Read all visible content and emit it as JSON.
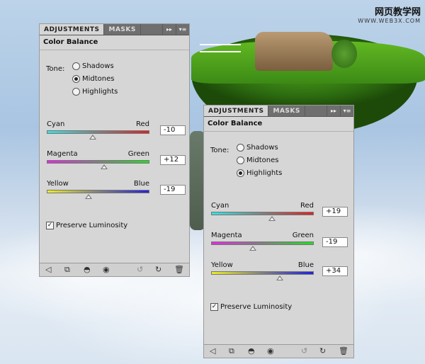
{
  "watermark": {
    "title": "网页教学网",
    "url": "WWW.WEB3X.COM"
  },
  "panel_left": {
    "tabs": {
      "active": "ADJUSTMENTS",
      "inactive": "MASKS"
    },
    "header_buttons": {
      "expand": "▸▸",
      "menu": "▾≡"
    },
    "title": "Color Balance",
    "tone": {
      "label": "Tone:",
      "options": [
        {
          "label": "Shadows",
          "selected": false
        },
        {
          "label": "Midtones",
          "selected": true
        },
        {
          "label": "Highlights",
          "selected": false
        }
      ]
    },
    "sliders": [
      {
        "left": "Cyan",
        "right": "Red",
        "value": "-10",
        "level": -10
      },
      {
        "left": "Magenta",
        "right": "Green",
        "value": "+12",
        "level": 12
      },
      {
        "left": "Yellow",
        "right": "Blue",
        "value": "-19",
        "level": -19
      }
    ],
    "preserve": {
      "label": "Preserve Luminosity",
      "checked": true,
      "mark": "✓"
    },
    "footer_icons": [
      "back-icon",
      "clip-icon",
      "visibility-mask-icon",
      "eye-icon",
      "reset-previous-icon",
      "reset-icon",
      "trash-icon"
    ]
  },
  "panel_right": {
    "tabs": {
      "active": "ADJUSTMENTS",
      "inactive": "MASKS"
    },
    "header_buttons": {
      "expand": "▸▸",
      "menu": "▾≡"
    },
    "title": "Color Balance",
    "tone": {
      "label": "Tone:",
      "options": [
        {
          "label": "Shadows",
          "selected": false
        },
        {
          "label": "Midtones",
          "selected": false
        },
        {
          "label": "Highlights",
          "selected": true
        }
      ]
    },
    "sliders": [
      {
        "left": "Cyan",
        "right": "Red",
        "value": "+19",
        "level": 19
      },
      {
        "left": "Magenta",
        "right": "Green",
        "value": "-19",
        "level": -19
      },
      {
        "left": "Yellow",
        "right": "Blue",
        "value": "+34",
        "level": 34
      }
    ],
    "preserve": {
      "label": "Preserve Luminosity",
      "checked": true,
      "mark": "✓"
    },
    "footer_icons": [
      "back-icon",
      "clip-icon",
      "visibility-mask-icon",
      "eye-icon",
      "reset-previous-icon",
      "reset-icon",
      "trash-icon"
    ]
  },
  "footer_glyphs": {
    "back": "◁",
    "clip": "⧉",
    "mask": "◓",
    "eye": "◉",
    "prev": "↺",
    "reset": "↻",
    "trash": "🗑"
  }
}
